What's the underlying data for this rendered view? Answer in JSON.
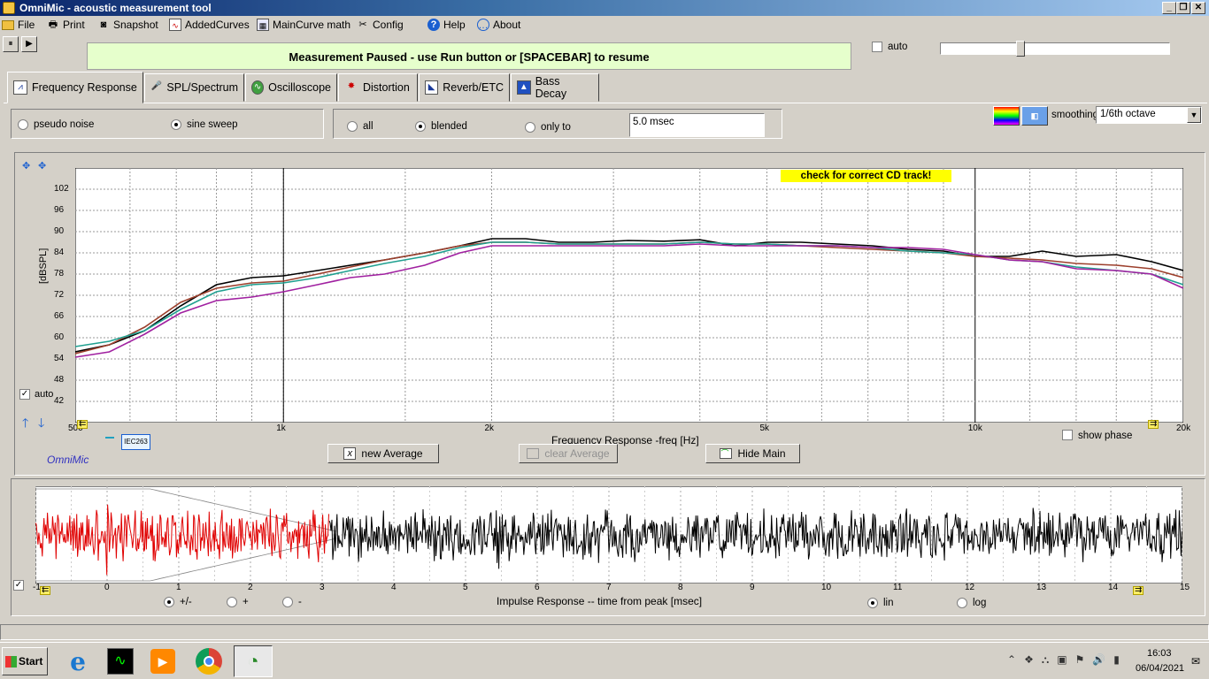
{
  "window": {
    "title": "OmniMic - acoustic measurement tool",
    "minimize": "_",
    "restore": "❐",
    "close": "✕"
  },
  "menu": [
    {
      "label": "File",
      "icon": "folder-icon"
    },
    {
      "label": "Print",
      "icon": "printer-icon"
    },
    {
      "label": "Snapshot",
      "icon": "camera-icon"
    },
    {
      "label": "AddedCurves",
      "icon": "curves-icon"
    },
    {
      "label": "MainCurve math",
      "icon": "calculator-icon"
    },
    {
      "label": "Config",
      "icon": "tools-icon"
    },
    {
      "label": "Help",
      "icon": "help-icon"
    },
    {
      "label": "About",
      "icon": "speech-bubble-icon"
    }
  ],
  "controls": {
    "pause_icon": "⏸",
    "play_icon": "▶",
    "auto_label": "auto",
    "slider_fraction": 0.34
  },
  "banner": "Measurement Paused - use Run button or [SPACEBAR] to resume",
  "tabs": [
    {
      "label": "Frequency Response",
      "icon": "graph-icon",
      "active": true
    },
    {
      "label": "SPL/Spectrum",
      "icon": "microphone-icon"
    },
    {
      "label": "Oscilloscope",
      "icon": "scope-icon"
    },
    {
      "label": "Distortion",
      "icon": "distortion-icon"
    },
    {
      "label": "Reverb/ETC",
      "icon": "reverb-icon"
    },
    {
      "label": "Bass Decay",
      "icon": "bass-decay-icon"
    }
  ],
  "signal": {
    "pseudo_noise": "pseudo noise",
    "sine_sweep": "sine sweep",
    "selected": "sine_sweep"
  },
  "gating": {
    "all": "all",
    "blended": "blended",
    "only_to": "only to",
    "selected": "blended",
    "time_value": "5.0 msec"
  },
  "smoothing": {
    "label": "smoothing",
    "value": "1/6th octave"
  },
  "fr_chart": {
    "warning": "check for correct CD track!",
    "auto_label": "auto",
    "ylabel": "[dBSPL]",
    "xlabel": "Frequency Response -freq [Hz]",
    "y_ticks": [
      "102",
      "96",
      "90",
      "84",
      "78",
      "72",
      "66",
      "60",
      "54",
      "48",
      "42"
    ],
    "x_ticks": [
      {
        "label": "500",
        "f": 500
      },
      {
        "label": "1k",
        "f": 1000
      },
      {
        "label": "2k",
        "f": 2000
      },
      {
        "label": "5k",
        "f": 5000
      },
      {
        "label": "10k",
        "f": 10000
      },
      {
        "label": "20k",
        "f": 20000
      }
    ],
    "legend_tag": "IEC263",
    "brand": "OmniMic",
    "show_phase_label": "show phase",
    "btn_new_average": "new Average",
    "btn_clear_average": "clear Average",
    "btn_hide_main": "Hide Main"
  },
  "chart_data": [
    {
      "type": "line",
      "xlabel": "Frequency Response -freq [Hz]",
      "ylabel": "[dBSPL]",
      "xscale": "log",
      "xlim": [
        500,
        20000
      ],
      "ylim": [
        36,
        108
      ],
      "grid": true,
      "series": [
        {
          "color": "#000000",
          "x": [
            500,
            560,
            630,
            710,
            800,
            900,
            1000,
            1120,
            1250,
            1400,
            1600,
            1800,
            2000,
            2240,
            2500,
            2800,
            3150,
            3550,
            4000,
            4500,
            5000,
            5600,
            6300,
            7100,
            8000,
            9000,
            10000,
            11200,
            12500,
            14000,
            16000,
            18000,
            20000
          ],
          "y": [
            56,
            58,
            62,
            69,
            75,
            77,
            77.5,
            79,
            80.5,
            82,
            84,
            86,
            88,
            88,
            87,
            87,
            87.5,
            87.3,
            87.7,
            86,
            87,
            87,
            86.5,
            86,
            85,
            84.5,
            83,
            83,
            84.5,
            83,
            83.5,
            81.5,
            79
          ]
        },
        {
          "color": "#9c3f2c",
          "x": [
            500,
            560,
            630,
            710,
            800,
            900,
            1000,
            1120,
            1250,
            1400,
            1600,
            1800,
            2000,
            2240,
            2500,
            2800,
            3150,
            3550,
            4000,
            4500,
            5000,
            5600,
            6300,
            7100,
            8000,
            9000,
            10000,
            11200,
            12500,
            14000,
            16000,
            18000,
            20000
          ],
          "y": [
            55.5,
            58,
            63,
            70,
            74,
            75.5,
            76,
            78,
            80,
            82,
            84,
            86,
            87,
            87,
            86.5,
            86.5,
            86.5,
            86.5,
            87,
            86.5,
            86.5,
            86,
            85.5,
            85,
            84.5,
            84,
            83,
            82.5,
            82,
            81,
            80.5,
            79.5,
            77
          ]
        },
        {
          "color": "#20a090",
          "x": [
            500,
            560,
            630,
            710,
            800,
            900,
            1000,
            1120,
            1250,
            1400,
            1600,
            1800,
            2000,
            2240,
            2500,
            2800,
            3150,
            3550,
            4000,
            4500,
            5000,
            5600,
            6300,
            7100,
            8000,
            9000,
            10000,
            11200,
            12500,
            14000,
            16000,
            18000,
            20000
          ],
          "y": [
            57.5,
            59,
            62,
            68,
            73,
            75,
            75.5,
            77,
            79,
            81,
            83,
            85.5,
            87,
            87,
            86.5,
            86.5,
            86.5,
            86.5,
            87,
            86.5,
            86.5,
            86,
            86,
            85.5,
            84.5,
            84,
            83.5,
            82,
            81.5,
            80,
            79,
            78,
            75
          ]
        },
        {
          "color": "#a020a0",
          "x": [
            500,
            560,
            630,
            710,
            800,
            900,
            1000,
            1120,
            1250,
            1400,
            1600,
            1800,
            2000,
            2240,
            2500,
            2800,
            3150,
            3550,
            4000,
            4500,
            5000,
            5600,
            6300,
            7100,
            8000,
            9000,
            10000,
            11200,
            12500,
            14000,
            16000,
            18000,
            20000
          ],
          "y": [
            54.5,
            56,
            61,
            67,
            70.5,
            71.5,
            73,
            75,
            77,
            78,
            80.5,
            84,
            86,
            86,
            86,
            86,
            86,
            86,
            86.5,
            86,
            86,
            86,
            86,
            85.5,
            85.5,
            85,
            83.5,
            82,
            81.5,
            79.5,
            79,
            78,
            74
          ]
        }
      ]
    },
    {
      "type": "line",
      "xlabel": "Impulse Response  -- time from peak [msec]",
      "xlim": [
        -1,
        15
      ],
      "grid": true,
      "series": [
        {
          "color": "#e00000",
          "x_range": [
            -1,
            3.1
          ]
        },
        {
          "color": "#000000",
          "x_range": [
            3.1,
            15
          ]
        }
      ]
    }
  ],
  "impulse": {
    "xlabel": "Impulse Response  -- time from peak [msec]",
    "x_ticks": [
      "-1",
      "0",
      "1",
      "2",
      "3",
      "4",
      "5",
      "6",
      "7",
      "8",
      "9",
      "10",
      "11",
      "12",
      "13",
      "14",
      "15"
    ],
    "polarity_pm": "+/-",
    "polarity_plus": "+",
    "polarity_minus": "-",
    "lin": "lin",
    "log": "log",
    "polarity_selected": "pm",
    "scale_selected": "lin"
  },
  "taskbar": {
    "start": "Start",
    "apps": [
      "ie-icon",
      "omnimic-app-icon",
      "media-player-icon",
      "chrome-icon",
      "active-app-icon"
    ],
    "clock_time": "16:03",
    "clock_date": "06/04/2021"
  }
}
